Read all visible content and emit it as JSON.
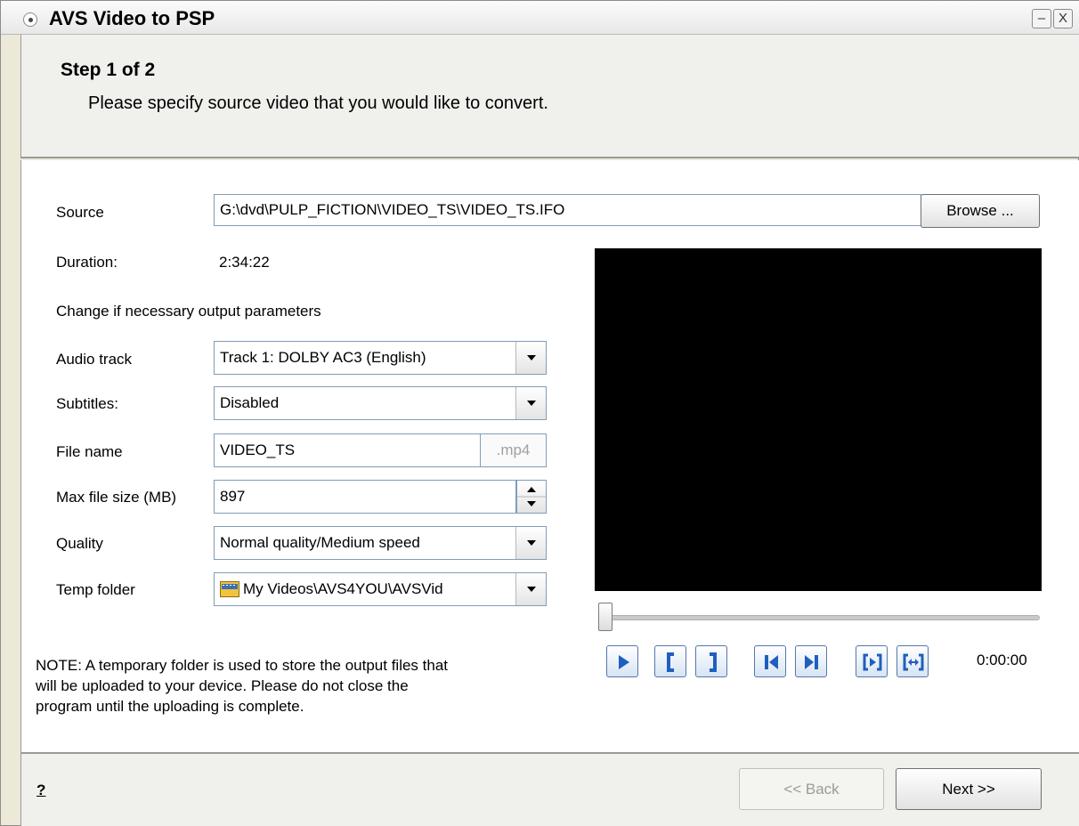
{
  "window": {
    "title": "AVS Video to PSP",
    "minimize_label": "–",
    "close_label": "X"
  },
  "header": {
    "step": "Step 1 of 2",
    "description": "Please specify source video that you would like to convert."
  },
  "form": {
    "source_label": "Source",
    "source_value": "G:\\dvd\\PULP_FICTION\\VIDEO_TS\\VIDEO_TS.IFO",
    "browse_label": "Browse ...",
    "duration_label": "Duration:",
    "duration_value": "2:34:22",
    "section_text": "Change if necessary output parameters",
    "audio_label": "Audio track",
    "audio_value": "Track 1: DOLBY AC3 (English)",
    "subtitles_label": "Subtitles:",
    "subtitles_value": "Disabled",
    "filename_label": "File name",
    "filename_value": "VIDEO_TS",
    "filename_ext": ".mp4",
    "maxsize_label": "Max file size (MB)",
    "maxsize_value": "897",
    "quality_label": "Quality",
    "quality_value": "Normal quality/Medium speed",
    "temp_label": "Temp folder",
    "temp_value": "My Videos\\AVS4YOU\\AVSVid"
  },
  "note": {
    "line1": "NOTE: A temporary folder is used to store the output files that",
    "line2": "will be uploaded to your device. Please do not close the",
    "line3": "program until the uploading is complete."
  },
  "player": {
    "time": "0:00:00",
    "position": 0,
    "accent": "#1f5fbf"
  },
  "footer": {
    "help_label": "?",
    "back_label": "<< Back",
    "next_label": "Next >>"
  }
}
